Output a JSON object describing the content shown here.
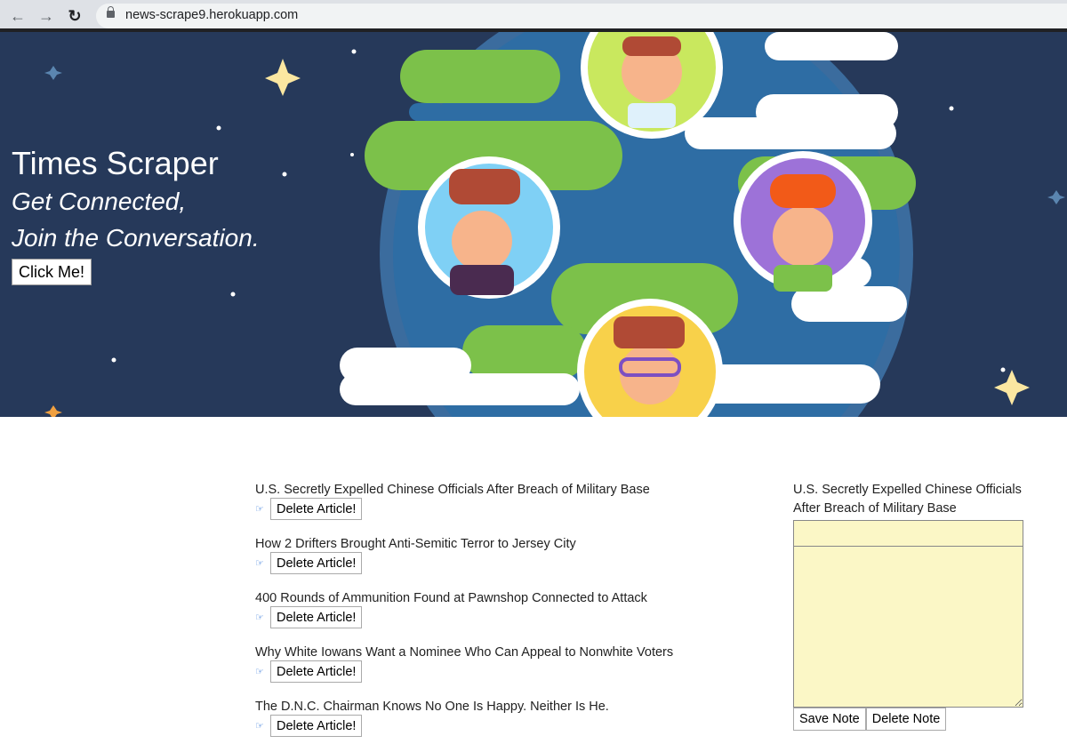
{
  "browser": {
    "url": "news-scrape9.herokuapp.com"
  },
  "hero": {
    "title": "Times Scraper",
    "subtitle_line1": "Get Connected,",
    "subtitle_line2": "Join the Conversation.",
    "button_label": "Click Me!",
    "colors": {
      "background": "#26395a",
      "ocean": "#2e6da4",
      "land": "#7cc14a",
      "star": "#fbe7a1"
    }
  },
  "articles": [
    {
      "title": "U.S. Secretly Expelled Chinese Officials After Breach of Military Base",
      "delete_label": "Delete Article!"
    },
    {
      "title": "How 2 Drifters Brought Anti-Semitic Terror to Jersey City",
      "delete_label": "Delete Article!"
    },
    {
      "title": "400 Rounds of Ammunition Found at Pawnshop Connected to Attack",
      "delete_label": "Delete Article!"
    },
    {
      "title": "Why White Iowans Want a Nominee Who Can Appeal to Nonwhite Voters",
      "delete_label": "Delete Article!"
    },
    {
      "title": "The D.N.C. Chairman Knows No One Is Happy. Neither Is He.",
      "delete_label": "Delete Article!"
    }
  ],
  "note": {
    "title": "U.S. Secretly Expelled Chinese Officials After Breach of Military Base",
    "title_value": "",
    "body_value": "",
    "save_label": "Save Note",
    "delete_label": "Delete Note",
    "background_color": "#fbf7c6"
  }
}
